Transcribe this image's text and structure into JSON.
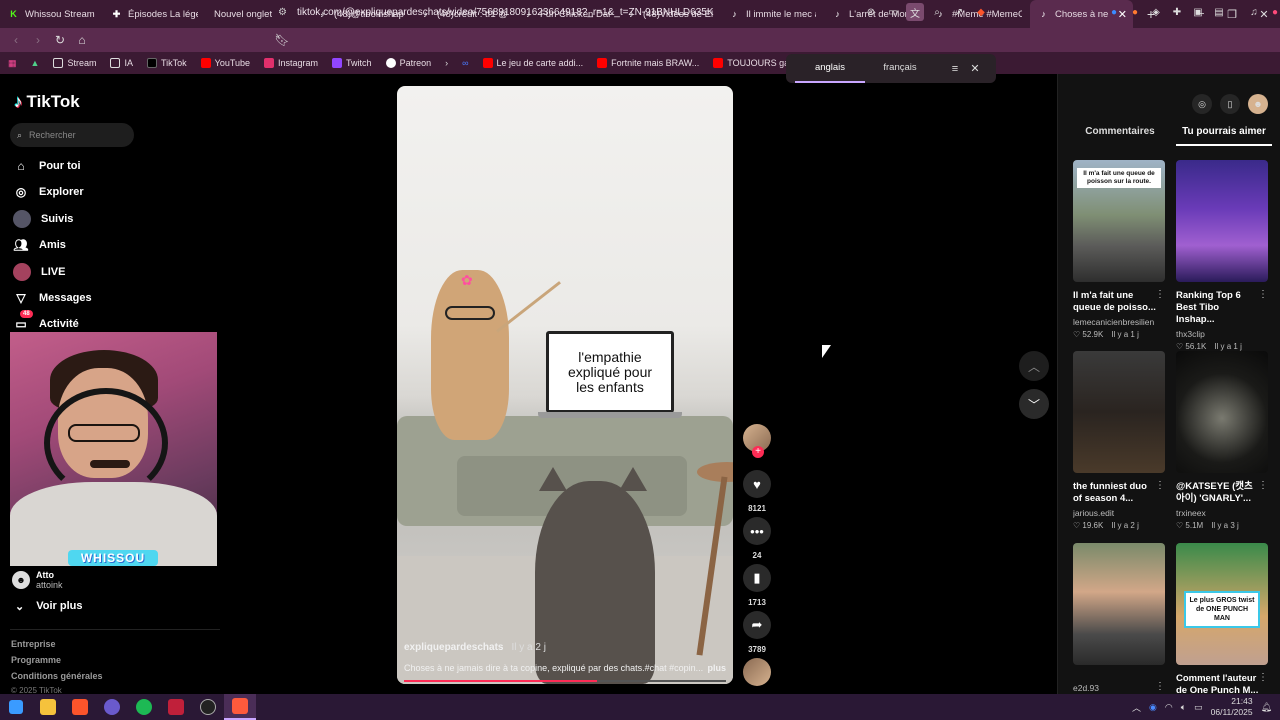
{
  "tabs": [
    {
      "title": "Whissou Stream – W",
      "icon": "kick-icon",
      "color": "#53fc18"
    },
    {
      "title": "Épisodes La légende",
      "icon": "plus-icon",
      "color": "#ffffff"
    },
    {
      "title": "Nouvel onglet",
      "icon": "none",
      "color": ""
    },
    {
      "title": "(48)@tiboinshape",
      "icon": "tiktok-icon",
      "color": "#ffffff"
    },
    {
      "title": "(48)crédit : tf1 @Tib",
      "icon": "tiktok-icon",
      "color": "#ffffff"
    },
    {
      "title": "Fun Chicken Dance",
      "icon": "tiktok-icon",
      "color": "#ffffff"
    },
    {
      "title": "(48)Vidéos de Elias",
      "icon": "tiktok-icon",
      "color": "#ffffff"
    },
    {
      "title": "Il immite le mec à",
      "icon": "tiktok-icon",
      "color": "#ffffff"
    },
    {
      "title": "L'arrêt de Morsang",
      "icon": "tiktok-icon",
      "color": "#ffffff"
    },
    {
      "title": "#Meme #MemeCut",
      "icon": "tiktok-icon",
      "color": "#ffffff"
    },
    {
      "title": "Choses à ne",
      "icon": "tiktok-icon",
      "color": "#ffffff",
      "active": true
    }
  ],
  "url": "tiktok.com/@expliquepardeschats/video/7568918091623664918?_r=1&_t=ZN-91BNHLD635K",
  "bookmarks": [
    "Stream",
    "IA",
    "TikTok",
    "YouTube",
    "Instagram",
    "Twitch",
    "Patreon",
    "Le jeu de carte addi...",
    "Fortnite mais BRAW...",
    "TOUJOURS gagner..."
  ],
  "translate": {
    "lang1": "anglais",
    "lang2": "français"
  },
  "sidebar": {
    "brand": "TikTok",
    "search_placeholder": "Rechercher",
    "items": [
      {
        "label": "Pour toi"
      },
      {
        "label": "Explorer"
      },
      {
        "label": "Suivis"
      },
      {
        "label": "Amis"
      },
      {
        "label": "LIVE"
      },
      {
        "label": "Messages"
      },
      {
        "label": "Activité",
        "badge": "48"
      }
    ],
    "webcam_label": "WHISSOU",
    "account": {
      "name": "Atto",
      "handle": "attoink"
    },
    "more": "Voir plus",
    "footer": [
      "Entreprise",
      "Programme",
      "Conditions générales",
      "© 2025 TikTok"
    ]
  },
  "video": {
    "screen_text": "l'empathie\nexpliqué pour\nles enfants",
    "author": "expliquepardeschats",
    "date": "Il y a 2 j",
    "description": "Choses à ne jamais dire à ta copine, expliqué par des chats.#chat #copin...",
    "more": "plus",
    "progress": 0.6
  },
  "actions": {
    "likes": "8121",
    "comments": "24",
    "saves": "1713",
    "shares": "3789"
  },
  "right": {
    "tab1": "Commentaires",
    "tab2": "Tu pourrais aimer",
    "cards": [
      {
        "title": "Il m'a fait une\nqueue de poisso...",
        "author": "lemecanicienbresilien",
        "likes": "52.9K",
        "date": "Il y a 1 j",
        "overlay": "Il m'a fait une queue de poisson sur la route."
      },
      {
        "title": "Ranking Top 6\nBest Tibo Inshap...",
        "author": "thx3clip",
        "likes": "56.1K",
        "date": "Il y a 1 j",
        "overlay": ""
      },
      {
        "title": "the funniest duo\nof season 4...",
        "author": "jarious.edit",
        "likes": "19.6K",
        "date": "Il y a 2 j",
        "overlay": ""
      },
      {
        "title": "@KATSEYE (캣츠\n아이) 'GNARLY'...",
        "author": "trxineex",
        "likes": "5.1M",
        "date": "Il y a 3 j",
        "overlay": ""
      },
      {
        "title": "",
        "author": "e2d.93",
        "likes": "",
        "date": "",
        "overlay": ""
      },
      {
        "title": "Comment l'auteur\nde One Punch M...",
        "author": "",
        "likes": "",
        "date": "",
        "overlay": "Le plus GROS twist de ONE PUNCH MAN"
      }
    ]
  },
  "taskbar": {
    "time": "21:43",
    "date": "06/11/2025"
  }
}
